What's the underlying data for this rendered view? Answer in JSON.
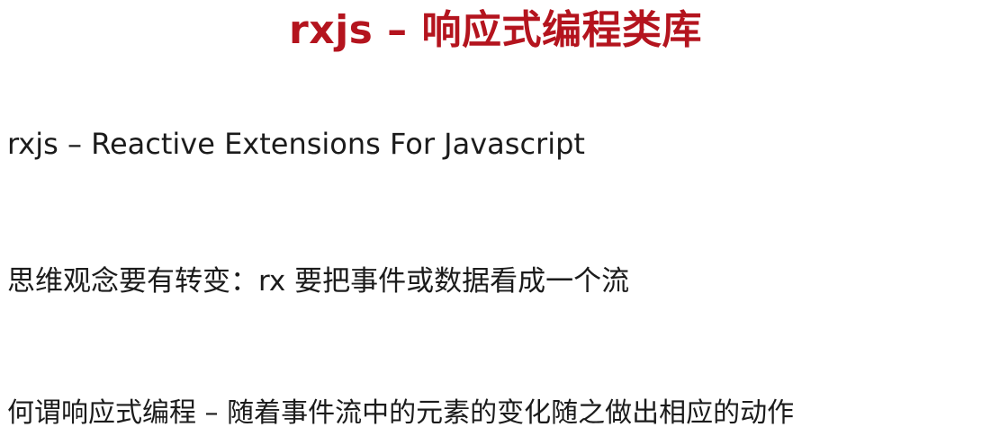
{
  "slide": {
    "title": "rxjs – 响应式编程类库",
    "lines": [
      "rxjs – Reactive Extensions For Javascript",
      "思维观念要有转变：rx 要把事件或数据看成一个流",
      "何谓响应式编程 – 随着事件流中的元素的变化随之做出相应的动作"
    ]
  },
  "colors": {
    "title": "#b4141e",
    "text": "#1b1b1b",
    "background": "#ffffff"
  }
}
